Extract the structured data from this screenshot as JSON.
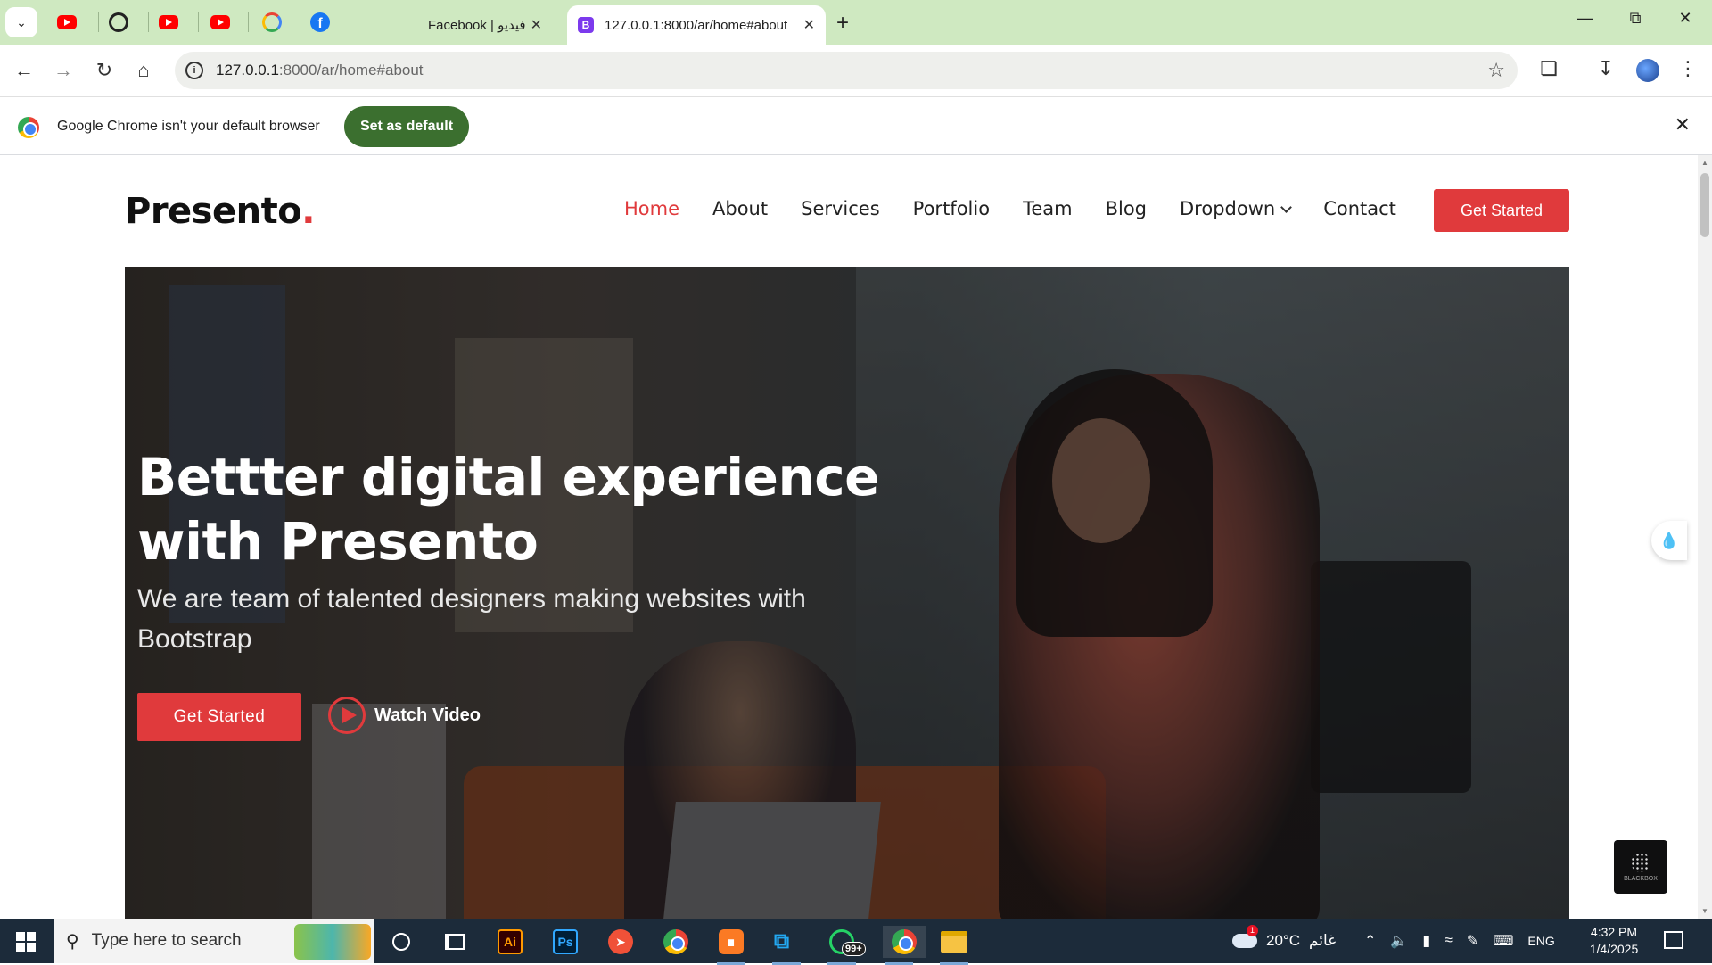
{
  "browser": {
    "pinned_tabs": [
      "youtube-icon",
      "github-icon",
      "youtube-icon",
      "youtube-icon",
      "google-icon",
      "facebook-icon"
    ],
    "tabs": [
      {
        "title": "Facebook | فيديو",
        "active": false
      },
      {
        "title": "127.0.0.1:8000/ar/home#about",
        "favicon": "B",
        "active": true
      }
    ],
    "url_host": "127.0.0.1",
    "url_rest": ":8000/ar/home#about",
    "infobar": {
      "message": "Google Chrome isn't your default browser",
      "button": "Set as default"
    }
  },
  "site": {
    "logo": "Presento",
    "logo_dot": ".",
    "nav": [
      {
        "label": "Home",
        "active": true
      },
      {
        "label": "About"
      },
      {
        "label": "Services"
      },
      {
        "label": "Portfolio"
      },
      {
        "label": "Team"
      },
      {
        "label": "Blog"
      },
      {
        "label": "Dropdown",
        "has_menu": true
      },
      {
        "label": "Contact"
      }
    ],
    "cta": "Get Started",
    "hero": {
      "title_line1": "Bettter digital experience",
      "title_line2": "with Presento",
      "subtitle": "We are team of talented designers making websites with Bootstrap",
      "primary_button": "Get Started",
      "video_link": "Watch Video"
    },
    "blackbox_label": "BLACKBOX",
    "accent_color": "#e03a3c"
  },
  "taskbar": {
    "search_placeholder": "Type here to search",
    "weather_temp": "20°C",
    "weather_desc": "غائم",
    "weather_badge": "1",
    "whatsapp_badge": "99+",
    "language": "ENG",
    "time": "4:32 PM",
    "date": "1/4/2025"
  }
}
